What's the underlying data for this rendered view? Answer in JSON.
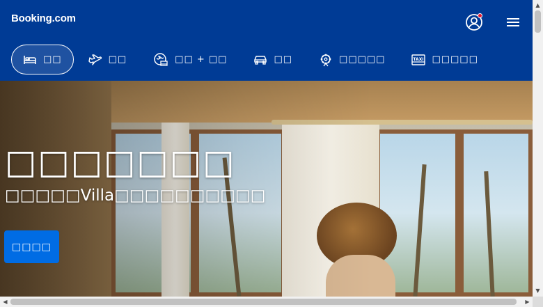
{
  "header": {
    "logo": "Booking.com",
    "account_label": "",
    "colors": {
      "brand_blue": "#003b95",
      "accent_blue": "#006ce4",
      "notification_red": "#e3132e"
    }
  },
  "nav": {
    "items": [
      {
        "icon": "bed-icon",
        "label": "□□",
        "active": true
      },
      {
        "icon": "plane-icon",
        "label": "□□",
        "active": false
      },
      {
        "icon": "plane-bed-icon",
        "label": "□□ + □□",
        "active": false
      },
      {
        "icon": "car-icon",
        "label": "□□",
        "active": false
      },
      {
        "icon": "attractions-icon",
        "label": "□□□□□",
        "active": false
      },
      {
        "icon": "taxi-icon",
        "label": "□□□□□",
        "active": false
      }
    ]
  },
  "hero": {
    "title": "□□□□□□□",
    "subtitle": "□□□□□Villa□□□□□□□□□□",
    "cta_label": "□□□□"
  },
  "scrollbars": {
    "up": "▲",
    "down": "▼",
    "left": "◀",
    "right": "▶"
  }
}
